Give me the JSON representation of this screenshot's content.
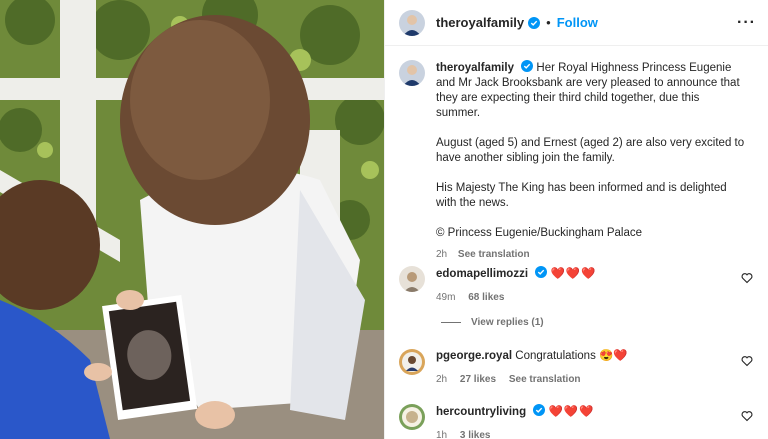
{
  "post": {
    "username": "theroyalfamily",
    "follow_label": "Follow",
    "more_icon": "more-horizontal-icon",
    "caption_p1": "Her Royal Highness Princess Eugenie and Mr Jack Brooksbank are very pleased to announce that they are expecting their third child together, due this summer.",
    "caption_p2": "August (aged 5) and Ernest (aged 2) are also very excited to have another sibling join the family.",
    "caption_p3": "His Majesty The King has been informed and is delighted with the news.",
    "caption_p4": "© Princess Eugenie/Buckingham Palace",
    "time": "2h",
    "see_translation": "See translation"
  },
  "comments": [
    {
      "username": "edomapellimozzi",
      "text": "❤️❤️❤️",
      "time": "49m",
      "likes": "68 likes",
      "extra": ""
    },
    {
      "username": "pgeorge.royal",
      "text": "Congratulations 😍❤️",
      "time": "2h",
      "likes": "27 likes",
      "extra": "See translation"
    },
    {
      "username": "hercountryliving",
      "text": "❤️❤️❤️",
      "time": "1h",
      "likes": "3 likes",
      "extra": ""
    }
  ],
  "view_replies": "View replies (1)",
  "colors": {
    "link_blue": "#0095f6",
    "verified_blue": "#0095f6",
    "muted": "#737373",
    "heart_red": "#ed4956"
  }
}
